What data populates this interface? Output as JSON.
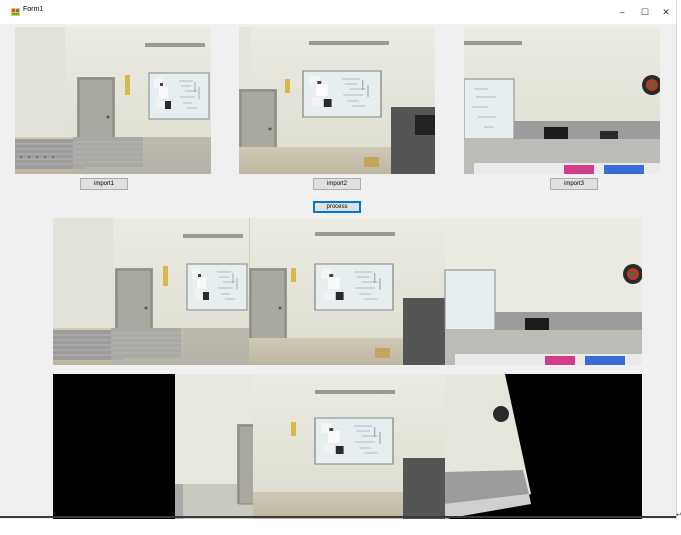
{
  "window": {
    "title": "Form1",
    "controls": {
      "minimize": "–",
      "maximize": "☐",
      "close": "✕"
    }
  },
  "buttons": {
    "import1": "import1",
    "import2": "import2",
    "import3": "import3",
    "process": "process"
  },
  "icons": {
    "app": "form-app-icon",
    "resize": "resize-corner-icon"
  },
  "colors": {
    "title_bg": "#ffffff",
    "client_bg": "#f0f0f0",
    "button_bg": "#e1e1e1",
    "focus_border": "#0078d7"
  }
}
